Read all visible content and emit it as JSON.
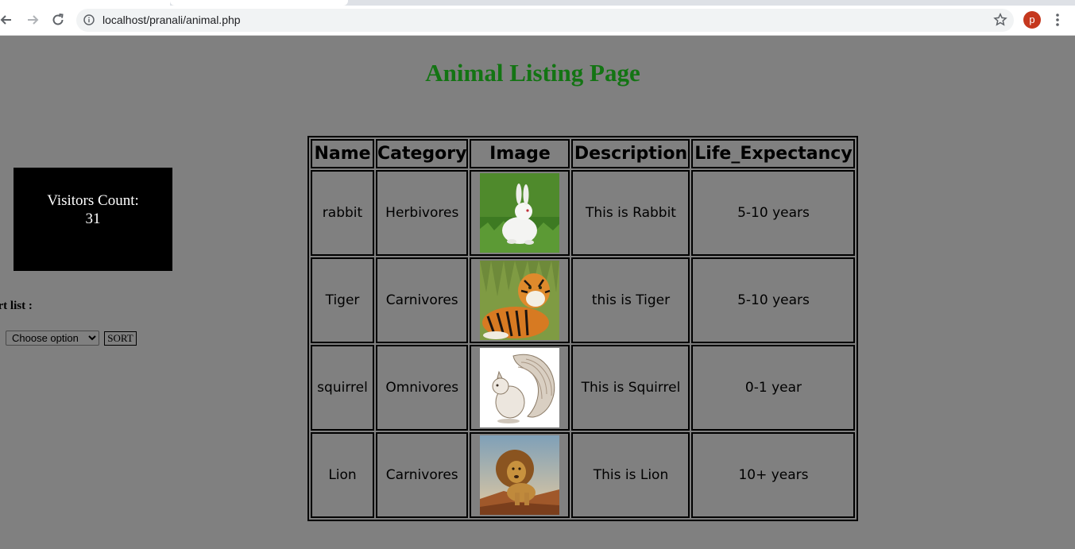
{
  "browser": {
    "url": "localhost/pranali/animal.php",
    "profile_initial": "p"
  },
  "page": {
    "title": "Animal Listing Page"
  },
  "visitors": {
    "label": "Visitors Count:",
    "count": "31"
  },
  "sort": {
    "label": "ort list :",
    "selected_option": "Choose option",
    "button_label": "SORT"
  },
  "table": {
    "headers": [
      "Name",
      "Category",
      "Image",
      "Description",
      "Life_Expectancy"
    ],
    "rows": [
      {
        "name": "rabbit",
        "category": "Herbivores",
        "image": "rabbit",
        "description": "This is Rabbit",
        "life": "5-10 years"
      },
      {
        "name": "Tiger",
        "category": "Carnivores",
        "image": "tiger",
        "description": "this is Tiger",
        "life": "5-10 years"
      },
      {
        "name": "squirrel",
        "category": "Omnivores",
        "image": "squirrel",
        "description": "This is Squirrel",
        "life": "0-1 year"
      },
      {
        "name": "Lion",
        "category": "Carnivores",
        "image": "lion",
        "description": "This is Lion",
        "life": "10+ years"
      }
    ]
  }
}
